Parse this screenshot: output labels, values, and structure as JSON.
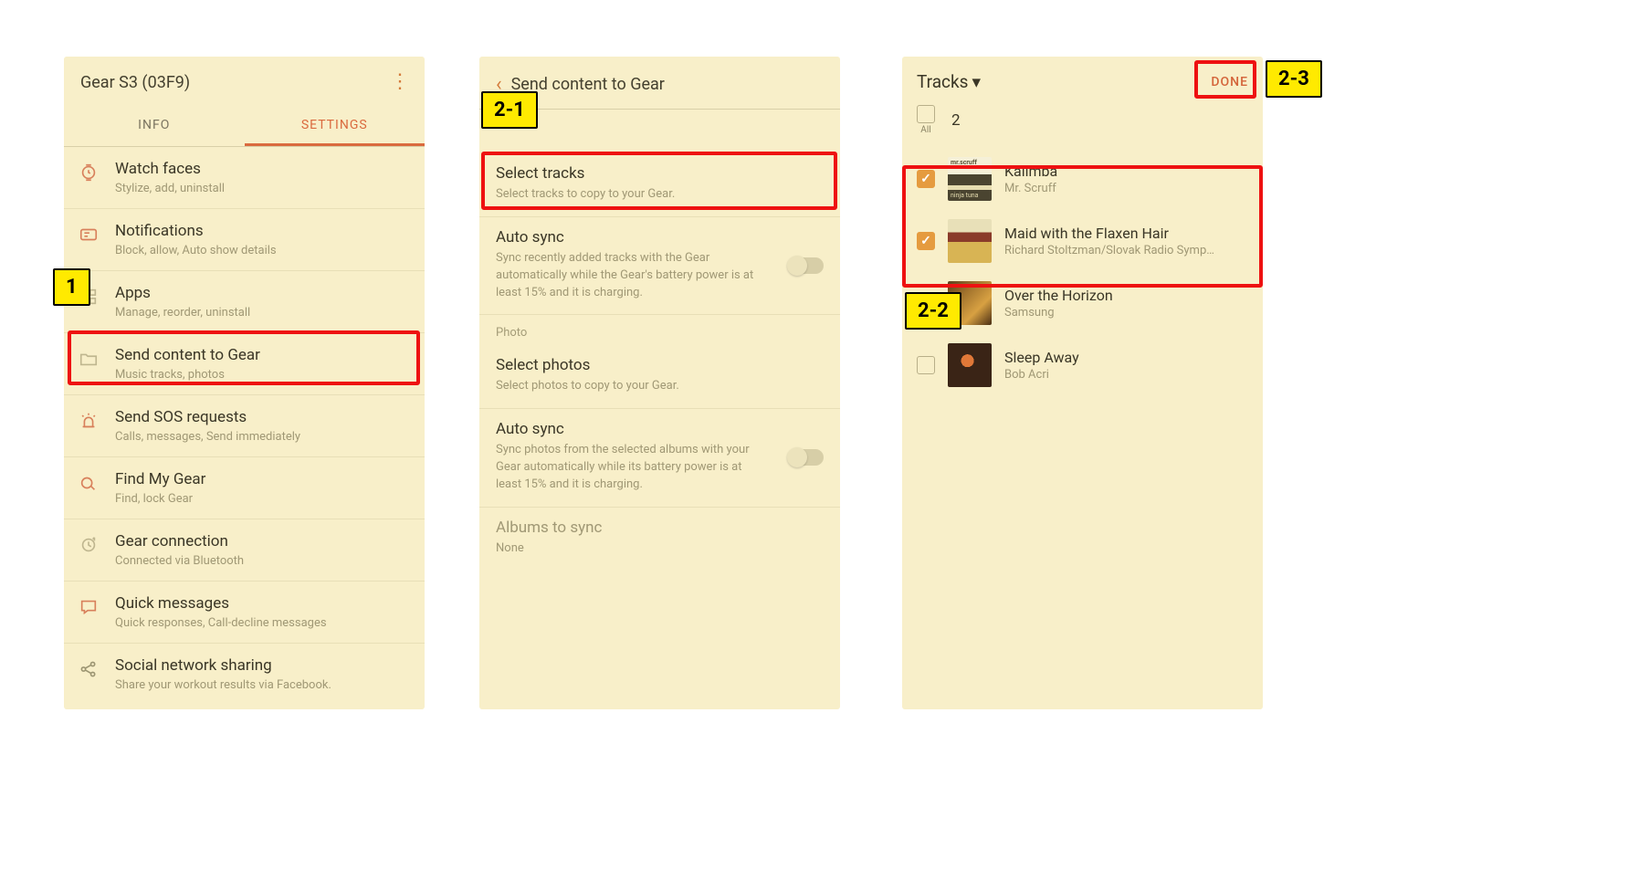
{
  "phone1": {
    "title": "Gear S3 (03F9)",
    "tabs": {
      "info": "INFO",
      "settings": "SETTINGS"
    },
    "items": [
      {
        "title": "Watch faces",
        "subtitle": "Stylize, add, uninstall"
      },
      {
        "title": "Notifications",
        "subtitle": "Block, allow, Auto show details"
      },
      {
        "title": "Apps",
        "subtitle": "Manage, reorder, uninstall"
      },
      {
        "title": "Send content to Gear",
        "subtitle": "Music tracks, photos"
      },
      {
        "title": "Send SOS requests",
        "subtitle": "Calls, messages, Send immediately"
      },
      {
        "title": "Find My Gear",
        "subtitle": "Find, lock Gear"
      },
      {
        "title": "Gear connection",
        "subtitle": "Connected via Bluetooth"
      },
      {
        "title": "Quick messages",
        "subtitle": "Quick responses, Call-decline messages"
      },
      {
        "title": "Social network sharing",
        "subtitle": "Share your workout results via Facebook."
      }
    ]
  },
  "phone2": {
    "header": "Send content to Gear",
    "selectTracks": {
      "title": "Select tracks",
      "subtitle": "Select tracks to copy to your Gear."
    },
    "autoSync1": {
      "title": "Auto sync",
      "subtitle": "Sync recently added tracks with the Gear automatically while the Gear's battery power is at least 15% and it is charging."
    },
    "photoSection": "Photo",
    "selectPhotos": {
      "title": "Select photos",
      "subtitle": "Select photos to copy to your Gear."
    },
    "autoSync2": {
      "title": "Auto sync",
      "subtitle": "Sync photos from the selected albums with your Gear automatically while its battery power is at least 15% and it is charging."
    },
    "albums": {
      "title": "Albums to sync",
      "subtitle": "None"
    }
  },
  "phone3": {
    "dropdown": "Tracks",
    "done": "DONE",
    "allLabel": "All",
    "count": "2",
    "tracks": [
      {
        "title": "Kalimba",
        "artist": "Mr. Scruff",
        "checked": true,
        "artLabel1": "mr.scruff",
        "artLabel2": "ninja tuna"
      },
      {
        "title": "Maid with the Flaxen Hair",
        "artist": "Richard Stoltzman/Slovak Radio Symp…",
        "checked": true
      },
      {
        "title": "Over the Horizon",
        "artist": "Samsung",
        "checked": false
      },
      {
        "title": "Sleep Away",
        "artist": "Bob Acri",
        "checked": false
      }
    ]
  },
  "callouts": {
    "c1": "1",
    "c21": "2-1",
    "c22": "2-2",
    "c23": "2-3"
  }
}
